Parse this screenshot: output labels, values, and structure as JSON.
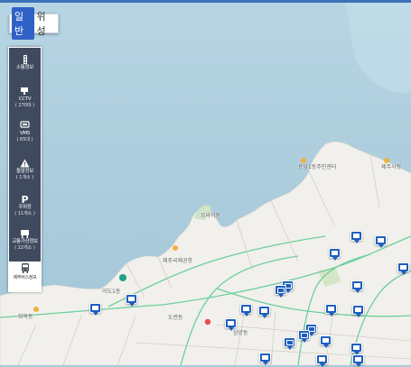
{
  "map_mode": {
    "normal": "일반",
    "satellite": "위성",
    "active": "normal"
  },
  "panel": {
    "items": [
      {
        "label": "소통정보",
        "sub": "",
        "icon": "traffic-light-icon"
      },
      {
        "label": "CCTV",
        "sub": "( 270대 )",
        "icon": "cctv-icon"
      },
      {
        "label": "VMS",
        "sub": "( 65대 )",
        "icon": "vms-sign-icon"
      },
      {
        "label": "돌발정보",
        "sub": "( 1개소 )",
        "icon": "warning-icon"
      },
      {
        "label": "주차장",
        "sub": "( 11개소 )",
        "icon": "parking-icon"
      },
      {
        "label": "교통가상정보",
        "sub": "( 22개소 )",
        "icon": "traffic-sign-icon"
      }
    ],
    "bus": {
      "label": "제주버스정보",
      "icon": "bus-icon"
    }
  },
  "map_labels": {
    "l1": "용담1동주민센터",
    "l2": "오라이동",
    "l3": "제주국제공항",
    "l4": "이도1동",
    "l5": "도련동",
    "l6": "화북동",
    "l7": "삼양동",
    "l8": "제주시청"
  },
  "colors": {
    "water": "#a9ccdc",
    "land": "#f1f0ec",
    "road": "#6dcf9c",
    "marker": "#1e5fbf",
    "panel": "#3f4a5e",
    "accent": "#2f62c4"
  }
}
